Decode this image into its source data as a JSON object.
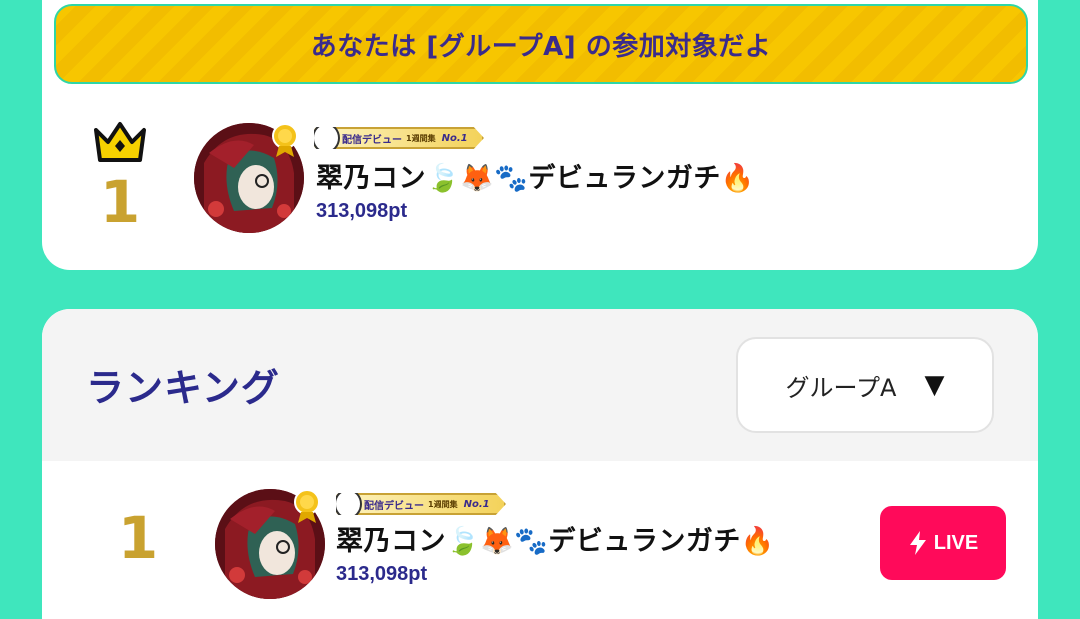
{
  "top_card": {
    "banner_text": "あなたは [グループA] の参加対象だよ",
    "my_rank": "1",
    "user": {
      "name": "翠乃コン🍃🦊🐾デビュランガチ🔥",
      "points": "313,098pt",
      "badge": {
        "main": "配信デビュー",
        "sub": "1週間集",
        "tag": "No.1"
      }
    }
  },
  "ranking": {
    "title": "ランキング",
    "group_select": {
      "selected": "グループA",
      "icon": "dropdown-triangle-icon"
    },
    "rows": [
      {
        "rank": "1",
        "name": "翠乃コン🍃🦊🐾デビュランガチ🔥",
        "points": "313,098pt",
        "badge": {
          "main": "配信デビュー",
          "sub": "1週間集",
          "tag": "No.1"
        },
        "live_label": "LIVE"
      }
    ]
  },
  "colors": {
    "background": "#3fe6bd",
    "banner": "#f7c600",
    "accent_text": "#2b2a8c",
    "rank_gold": "#c9a230",
    "live": "#ff0a5a"
  },
  "icons": [
    "crown-icon",
    "medal-icon",
    "badge-mascot-icon",
    "dropdown-triangle-icon",
    "lightning-icon"
  ]
}
